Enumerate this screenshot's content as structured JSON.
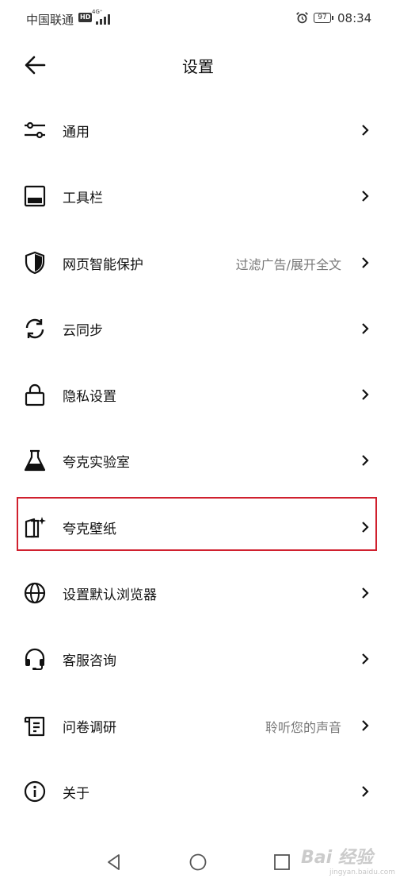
{
  "status_bar": {
    "carrier": "中国联通",
    "hd": "HD",
    "network": "4G⁺",
    "battery": "97",
    "time": "08:34"
  },
  "header": {
    "title": "设置"
  },
  "settings": [
    {
      "label": "通用",
      "value": "",
      "icon": "sliders-icon"
    },
    {
      "label": "工具栏",
      "value": "",
      "icon": "toolbar-icon"
    },
    {
      "label": "网页智能保护",
      "value": "过滤广告/展开全文",
      "icon": "shield-icon"
    },
    {
      "label": "云同步",
      "value": "",
      "icon": "sync-icon"
    },
    {
      "label": "隐私设置",
      "value": "",
      "icon": "lock-icon"
    },
    {
      "label": "夸克实验室",
      "value": "",
      "icon": "flask-icon"
    },
    {
      "label": "夸克壁纸",
      "value": "",
      "icon": "wallpaper-icon"
    },
    {
      "label": "设置默认浏览器",
      "value": "",
      "icon": "globe-icon"
    },
    {
      "label": "客服咨询",
      "value": "",
      "icon": "headset-icon"
    },
    {
      "label": "问卷调研",
      "value": "聆听您的声音",
      "icon": "survey-icon"
    },
    {
      "label": "关于",
      "value": "",
      "icon": "info-icon"
    }
  ],
  "highlight_color": "#d0202e",
  "watermark": {
    "text": "Bai 经验",
    "sub": "jingyan.baidu.com"
  }
}
